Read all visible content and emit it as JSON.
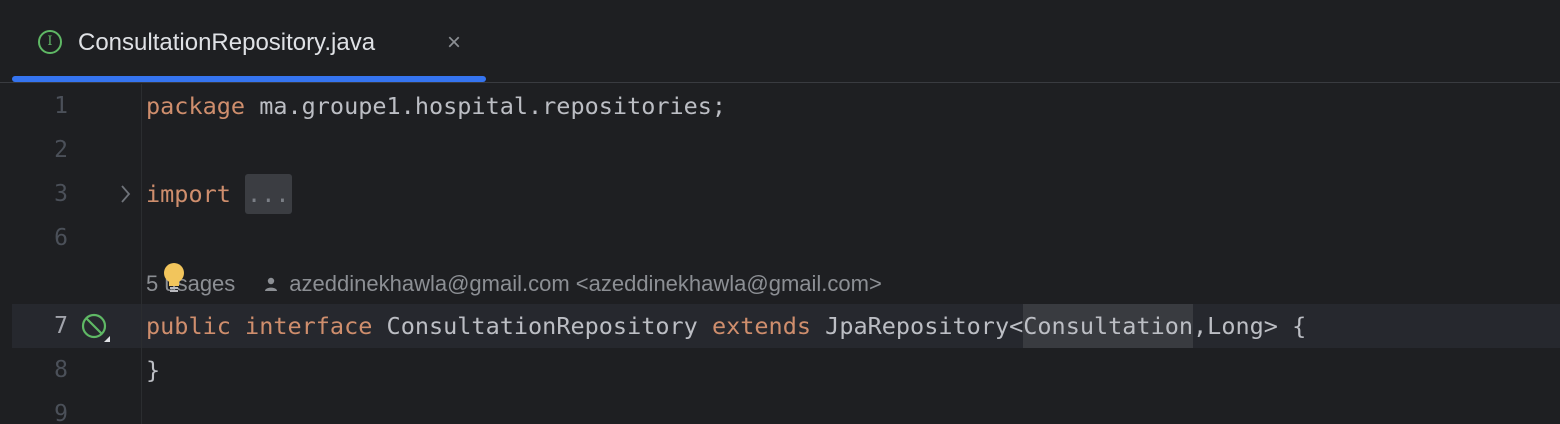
{
  "tab": {
    "icon": "interface-icon",
    "icon_letter": "I",
    "title": "ConsultationRepository.java",
    "close_glyph": "×"
  },
  "editor": {
    "line_numbers": [
      "1",
      "2",
      "3",
      "6",
      "7",
      "8",
      "9"
    ],
    "line1": {
      "keyword": "package",
      "rest": " ma.groupe1.hospital.repositories;"
    },
    "line3": {
      "keyword": "import",
      "folded": "..."
    },
    "inlay_hint": {
      "usages": "5 usages",
      "author": "azeddinekhawla@gmail.com <azeddinekhawla@gmail.com>"
    },
    "line7": {
      "kw_public": "public",
      "kw_interface": "interface",
      "name": "ConsultationRepository",
      "kw_extends": "extends",
      "parent": "JpaRepository<",
      "type_arg": "Consultation",
      "rest": ",Long> {"
    },
    "line8": "}"
  },
  "colors": {
    "background": "#1e1f22",
    "keyword": "#cf8e6d",
    "text": "#bcbec4",
    "accent": "#3574f0",
    "interface_icon": "#5fb865"
  }
}
